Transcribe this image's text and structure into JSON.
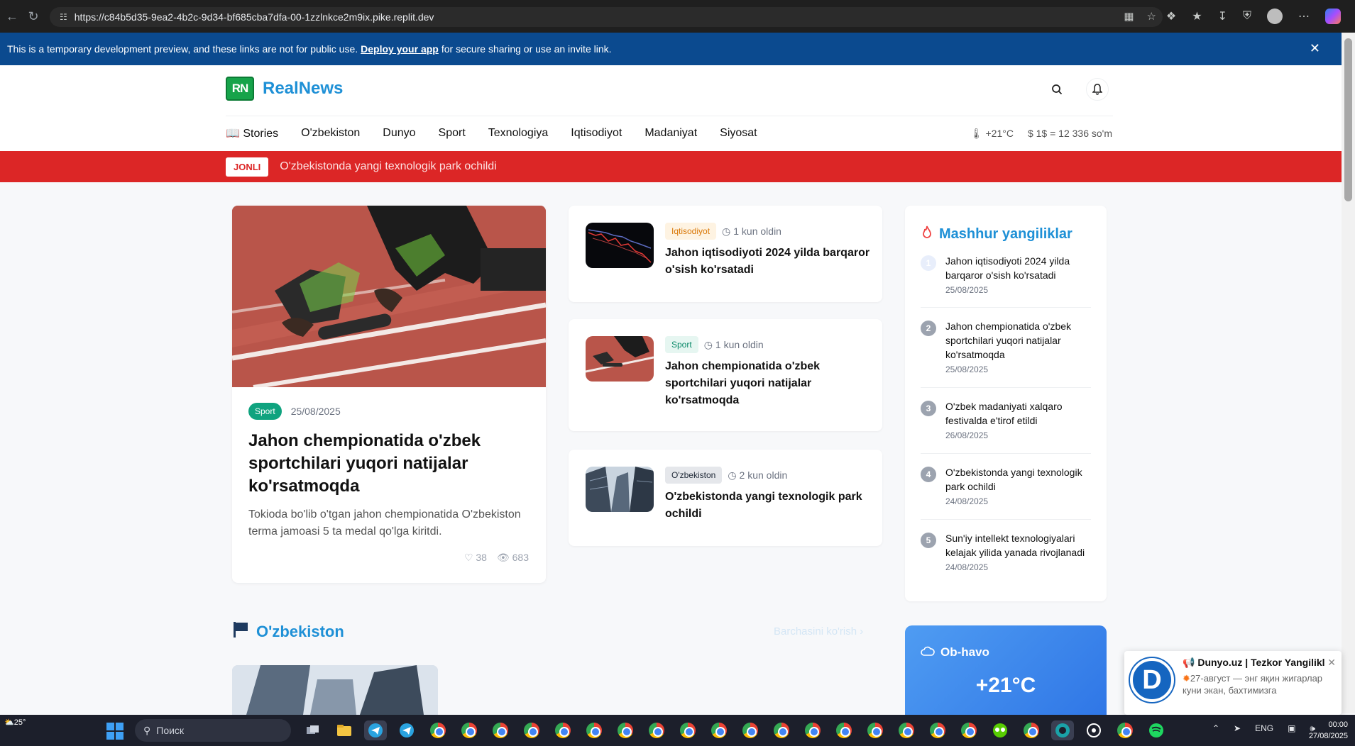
{
  "browser": {
    "url": "https://c84b5d35-9ea2-4b2c-9d34-bf685cba7dfa-00-1zzlnkce2m9ix.pike.replit.dev"
  },
  "preview_banner": {
    "text_before": "This is a temporary development preview, and these links are not for public use.",
    "link": "Deploy your app",
    "text_after": "for secure sharing or use an invite link."
  },
  "site": {
    "logo_mark": "RN",
    "logo_text": "RealNews",
    "nav": [
      "Stories",
      "O'zbekiston",
      "Dunyo",
      "Sport",
      "Texnologiya",
      "Iqtisodiyot",
      "Madaniyat",
      "Siyosat"
    ],
    "weather_small": "+21°C",
    "currency": "1$ = 12 336 so'm"
  },
  "breaking": {
    "badge": "JONLI",
    "text": "O'zbekistonda yangi texnologik park ochildi"
  },
  "featured": {
    "tag": "Sport",
    "date": "25/08/2025",
    "title": "Jahon chempionatida o'zbek sportchilari yuqori natijalar ko'rsatmoqda",
    "description": "Tokioda bo'lib o'tgan jahon chempionatida O'zbekiston terma jamoasi 5 ta medal qo'lga kiritdi.",
    "likes": "38",
    "views": "683"
  },
  "side_news": [
    {
      "tag": "Iqtisodiyot",
      "time": "1 kun oldin",
      "title": "Jahon iqtisodiyoti 2024 yilda barqaror o'sish ko'rsatadi"
    },
    {
      "tag": "Sport",
      "time": "1 kun oldin",
      "title": "Jahon chempionatida o'zbek sportchilari yuqori natijalar ko'rsatmoqda"
    },
    {
      "tag": "O'zbekiston",
      "time": "2 kun oldin",
      "title": "O'zbekistonda yangi texnologik park ochildi"
    }
  ],
  "trending": {
    "title": "Mashhur yangiliklar",
    "items": [
      {
        "num": "1",
        "title": "Jahon iqtisodiyoti 2024 yilda barqaror o'sish ko'rsatadi",
        "date": "25/08/2025"
      },
      {
        "num": "2",
        "title": "Jahon chempionatida o'zbek sportchilari yuqori natijalar ko'rsatmoqda",
        "date": "25/08/2025"
      },
      {
        "num": "3",
        "title": "O'zbek madaniyati xalqaro festivalda e'tirof etildi",
        "date": "26/08/2025"
      },
      {
        "num": "4",
        "title": "O'zbekistonda yangi texnologik park ochildi",
        "date": "24/08/2025"
      },
      {
        "num": "5",
        "title": "Sun'iy intellekt texnologiyalari kelajak yilida yanada rivojlanadi",
        "date": "24/08/2025"
      }
    ]
  },
  "section": {
    "title": "O'zbekiston",
    "see_all": "Barchasini ko'rish"
  },
  "weather": {
    "title": "Ob-havo",
    "temp": "+21°C"
  },
  "toast": {
    "title": "Dunyo.uz | Tezkor Yangiliklar",
    "body": "27-август — энг яқин жигарлар куни экан, бахтимизга"
  },
  "taskbar": {
    "weather": "25°",
    "search": "Поиск",
    "lang": "ENG",
    "time": "00:00",
    "date": "27/08/2025"
  }
}
